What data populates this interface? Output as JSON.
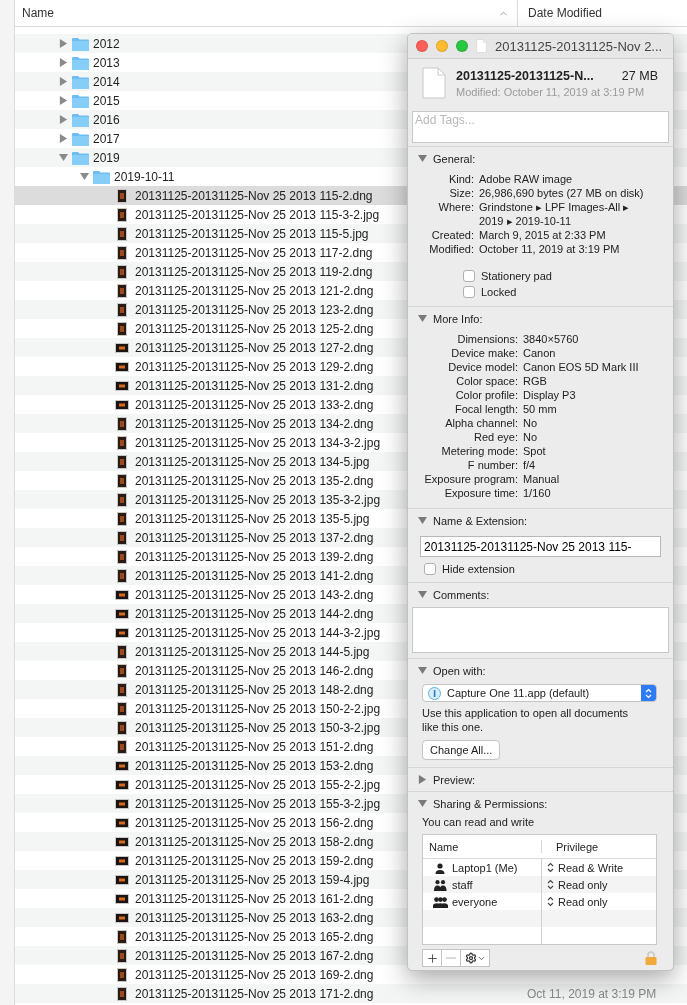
{
  "finder": {
    "columns": [
      "Name",
      "Date Modified"
    ],
    "tree": [
      {
        "name": "2012",
        "kind": "folder",
        "expanded": false,
        "selected": false
      },
      {
        "name": "2013",
        "kind": "folder",
        "expanded": false,
        "selected": false
      },
      {
        "name": "2014",
        "kind": "folder",
        "expanded": false,
        "selected": false
      },
      {
        "name": "2015",
        "kind": "folder",
        "expanded": false,
        "selected": false
      },
      {
        "name": "2016",
        "kind": "folder",
        "expanded": false,
        "selected": false
      },
      {
        "name": "2017",
        "kind": "folder",
        "expanded": false,
        "selected": false
      },
      {
        "name": "2019",
        "kind": "folder",
        "expanded": true,
        "selected": false,
        "children": [
          {
            "name": "2019-10-11",
            "kind": "folder",
            "expanded": true,
            "selected": false,
            "children": [
              {
                "name": "20131125-20131125-Nov 25 2013 115-2.dng",
                "kind": "portrait",
                "selected": true
              },
              {
                "name": "20131125-20131125-Nov 25 2013 115-3-2.jpg",
                "kind": "portrait",
                "selected": false
              },
              {
                "name": "20131125-20131125-Nov 25 2013 115-5.jpg",
                "kind": "portrait",
                "selected": false
              },
              {
                "name": "20131125-20131125-Nov 25 2013 117-2.dng",
                "kind": "portrait",
                "selected": false
              },
              {
                "name": "20131125-20131125-Nov 25 2013 119-2.dng",
                "kind": "portrait",
                "selected": false
              },
              {
                "name": "20131125-20131125-Nov 25 2013 121-2.dng",
                "kind": "portrait",
                "selected": false
              },
              {
                "name": "20131125-20131125-Nov 25 2013 123-2.dng",
                "kind": "portrait",
                "selected": false
              },
              {
                "name": "20131125-20131125-Nov 25 2013 125-2.dng",
                "kind": "portrait",
                "selected": false
              },
              {
                "name": "20131125-20131125-Nov 25 2013 127-2.dng",
                "kind": "landscape",
                "selected": false
              },
              {
                "name": "20131125-20131125-Nov 25 2013 129-2.dng",
                "kind": "landscape",
                "selected": false
              },
              {
                "name": "20131125-20131125-Nov 25 2013 131-2.dng",
                "kind": "landscape",
                "selected": false
              },
              {
                "name": "20131125-20131125-Nov 25 2013 133-2.dng",
                "kind": "landscape",
                "selected": false
              },
              {
                "name": "20131125-20131125-Nov 25 2013 134-2.dng",
                "kind": "portrait",
                "selected": false
              },
              {
                "name": "20131125-20131125-Nov 25 2013 134-3-2.jpg",
                "kind": "portrait",
                "selected": false
              },
              {
                "name": "20131125-20131125-Nov 25 2013 134-5.jpg",
                "kind": "portrait",
                "selected": false
              },
              {
                "name": "20131125-20131125-Nov 25 2013 135-2.dng",
                "kind": "portrait",
                "selected": false
              },
              {
                "name": "20131125-20131125-Nov 25 2013 135-3-2.jpg",
                "kind": "portrait",
                "selected": false
              },
              {
                "name": "20131125-20131125-Nov 25 2013 135-5.jpg",
                "kind": "portrait",
                "selected": false
              },
              {
                "name": "20131125-20131125-Nov 25 2013 137-2.dng",
                "kind": "portrait",
                "selected": false
              },
              {
                "name": "20131125-20131125-Nov 25 2013 139-2.dng",
                "kind": "portrait",
                "selected": false
              },
              {
                "name": "20131125-20131125-Nov 25 2013 141-2.dng",
                "kind": "portrait",
                "selected": false
              },
              {
                "name": "20131125-20131125-Nov 25 2013 143-2.dng",
                "kind": "landscape",
                "selected": false
              },
              {
                "name": "20131125-20131125-Nov 25 2013 144-2.dng",
                "kind": "landscape",
                "selected": false
              },
              {
                "name": "20131125-20131125-Nov 25 2013 144-3-2.jpg",
                "kind": "landscape",
                "selected": false
              },
              {
                "name": "20131125-20131125-Nov 25 2013 144-5.jpg",
                "kind": "portrait",
                "selected": false
              },
              {
                "name": "20131125-20131125-Nov 25 2013 146-2.dng",
                "kind": "portrait",
                "selected": false
              },
              {
                "name": "20131125-20131125-Nov 25 2013 148-2.dng",
                "kind": "portrait",
                "selected": false
              },
              {
                "name": "20131125-20131125-Nov 25 2013 150-2-2.jpg",
                "kind": "portrait",
                "selected": false
              },
              {
                "name": "20131125-20131125-Nov 25 2013 150-3-2.jpg",
                "kind": "portrait",
                "selected": false
              },
              {
                "name": "20131125-20131125-Nov 25 2013 151-2.dng",
                "kind": "portrait",
                "selected": false
              },
              {
                "name": "20131125-20131125-Nov 25 2013 153-2.dng",
                "kind": "landscape",
                "selected": false
              },
              {
                "name": "20131125-20131125-Nov 25 2013 155-2-2.jpg",
                "kind": "landscape",
                "selected": false
              },
              {
                "name": "20131125-20131125-Nov 25 2013 155-3-2.jpg",
                "kind": "landscape",
                "selected": false
              },
              {
                "name": "20131125-20131125-Nov 25 2013 156-2.dng",
                "kind": "landscape",
                "selected": false
              },
              {
                "name": "20131125-20131125-Nov 25 2013 158-2.dng",
                "kind": "landscape",
                "selected": false
              },
              {
                "name": "20131125-20131125-Nov 25 2013 159-2.dng",
                "kind": "landscape",
                "selected": false
              },
              {
                "name": "20131125-20131125-Nov 25 2013 159-4.jpg",
                "kind": "landscape",
                "selected": false
              },
              {
                "name": "20131125-20131125-Nov 25 2013 161-2.dng",
                "kind": "landscape",
                "selected": false
              },
              {
                "name": "20131125-20131125-Nov 25 2013 163-2.dng",
                "kind": "landscape",
                "selected": false
              },
              {
                "name": "20131125-20131125-Nov 25 2013 165-2.dng",
                "kind": "portrait",
                "selected": false
              },
              {
                "name": "20131125-20131125-Nov 25 2013 167-2.dng",
                "kind": "portrait",
                "selected": false
              },
              {
                "name": "20131125-20131125-Nov 25 2013 169-2.dng",
                "kind": "portrait",
                "selected": false
              },
              {
                "name": "20131125-20131125-Nov 25 2013 171-2.dng",
                "kind": "portrait",
                "selected": false,
                "date": "Oct 11, 2019 at 3:19 PM"
              }
            ]
          }
        ]
      }
    ]
  },
  "info": {
    "title": "20131125-20131125-Nov 2...",
    "name": "20131125-20131125-N...",
    "size": "27 MB",
    "modified": "Modified: October 11, 2019 at 3:19 PM",
    "tags": {
      "placeholder": "Add Tags..."
    },
    "sections": [
      {
        "kind": "general",
        "label": "General:",
        "expanded": true,
        "rows": [
          {
            "label": "Kind:",
            "value": "Adobe RAW image"
          },
          {
            "label": "Size:",
            "value": "26,986,690 bytes (27 MB on disk)"
          },
          {
            "label": "Where:",
            "value": "Grindstone ▸ LPF Images-All ▸\n2019 ▸ 2019-10-11"
          },
          {
            "label": "Created:",
            "value": "March 9, 2015 at 2:33 PM"
          },
          {
            "label": "Modified:",
            "value": "October 11, 2019 at 3:19 PM"
          }
        ],
        "options": [
          {
            "label": "Stationery pad",
            "checked": false
          },
          {
            "label": "Locked",
            "checked": false
          }
        ]
      },
      {
        "kind": "more_info",
        "label": "More Info:",
        "expanded": true,
        "rows": [
          {
            "label": "Dimensions:",
            "value": "3840×5760"
          },
          {
            "label": "Device make:",
            "value": "Canon"
          },
          {
            "label": "Device model:",
            "value": "Canon EOS 5D Mark III"
          },
          {
            "label": "Color space:",
            "value": "RGB"
          },
          {
            "label": "Color profile:",
            "value": "Display P3"
          },
          {
            "label": "Focal length:",
            "value": "50 mm"
          },
          {
            "label": "Alpha channel:",
            "value": "No"
          },
          {
            "label": "Red eye:",
            "value": "No"
          },
          {
            "label": "Metering mode:",
            "value": "Spot"
          },
          {
            "label": "F number:",
            "value": "f/4"
          },
          {
            "label": "Exposure program:",
            "value": "Manual"
          },
          {
            "label": "Exposure time:",
            "value": "1/160"
          }
        ]
      },
      {
        "kind": "name_extension",
        "label": "Name & Extension:",
        "expanded": true,
        "value": "20131125-20131125-Nov 25 2013 115-",
        "option": {
          "label": "Hide extension",
          "checked": false
        }
      },
      {
        "kind": "comments",
        "label": "Comments:",
        "expanded": true
      },
      {
        "kind": "open_with",
        "label": "Open with:",
        "expanded": true,
        "app": "Capture One 11.app (default)",
        "note": "Use this application to open all documents like this one.",
        "button": "Change All..."
      },
      {
        "kind": "preview",
        "label": "Preview:",
        "expanded": false
      },
      {
        "kind": "sharing",
        "label": "Sharing & Permissions:",
        "expanded": true,
        "note": "You can read and write",
        "columns": [
          "Name",
          "Privilege"
        ],
        "rows": [
          {
            "kind": "user",
            "name": "Laptop1 (Me)",
            "privilege": "Read & Write"
          },
          {
            "kind": "group",
            "name": "staff",
            "privilege": "Read only"
          },
          {
            "kind": "everyone",
            "name": "everyone",
            "privilege": "Read only"
          }
        ],
        "tools": [
          {
            "kind": "add",
            "disabled": false
          },
          {
            "kind": "remove",
            "disabled": true
          },
          {
            "kind": "action",
            "disabled": false
          }
        ]
      }
    ]
  }
}
